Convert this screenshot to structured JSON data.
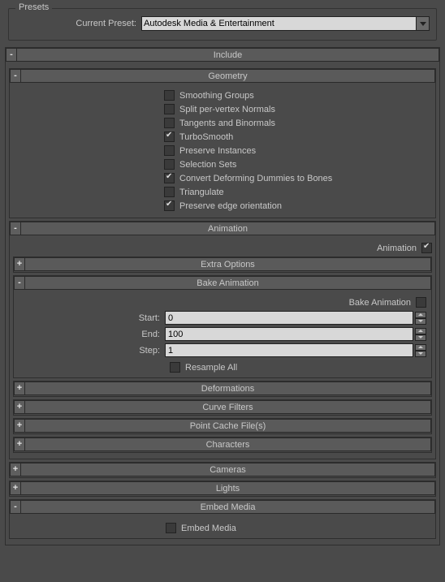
{
  "presets": {
    "legend": "Presets",
    "current_label": "Current Preset:",
    "current_value": "Autodesk Media & Entertainment"
  },
  "include": {
    "title": "Include",
    "geometry": {
      "title": "Geometry",
      "smoothing_groups": {
        "label": "Smoothing Groups",
        "checked": false
      },
      "split_per_vertex": {
        "label": "Split per-vertex Normals",
        "checked": false
      },
      "tangents_binormals": {
        "label": "Tangents and Binormals",
        "checked": false
      },
      "turbosmooth": {
        "label": "TurboSmooth",
        "checked": true
      },
      "preserve_instances": {
        "label": "Preserve Instances",
        "checked": false
      },
      "selection_sets": {
        "label": "Selection Sets",
        "checked": false
      },
      "convert_deforming": {
        "label": "Convert Deforming Dummies to Bones",
        "checked": true
      },
      "triangulate": {
        "label": "Triangulate",
        "checked": false
      },
      "preserve_edge": {
        "label": "Preserve edge orientation",
        "checked": true
      }
    },
    "animation": {
      "title": "Animation",
      "animation_check": {
        "label": "Animation",
        "checked": true
      },
      "extra_options": {
        "title": "Extra Options"
      },
      "bake": {
        "title": "Bake Animation",
        "bake_check": {
          "label": "Bake Animation",
          "checked": false
        },
        "start": {
          "label": "Start:",
          "value": "0"
        },
        "end": {
          "label": "End:",
          "value": "100"
        },
        "step": {
          "label": "Step:",
          "value": "1"
        },
        "resample": {
          "label": "Resample All",
          "checked": false
        }
      },
      "deformations": {
        "title": "Deformations"
      },
      "curve_filters": {
        "title": "Curve Filters"
      },
      "point_cache": {
        "title": "Point Cache File(s)"
      },
      "characters": {
        "title": "Characters"
      }
    },
    "cameras": {
      "title": "Cameras"
    },
    "lights": {
      "title": "Lights"
    },
    "embed_media": {
      "title": "Embed Media",
      "embed_check": {
        "label": "Embed Media",
        "checked": false
      }
    }
  },
  "glyphs": {
    "minus": "-",
    "plus": "+"
  }
}
